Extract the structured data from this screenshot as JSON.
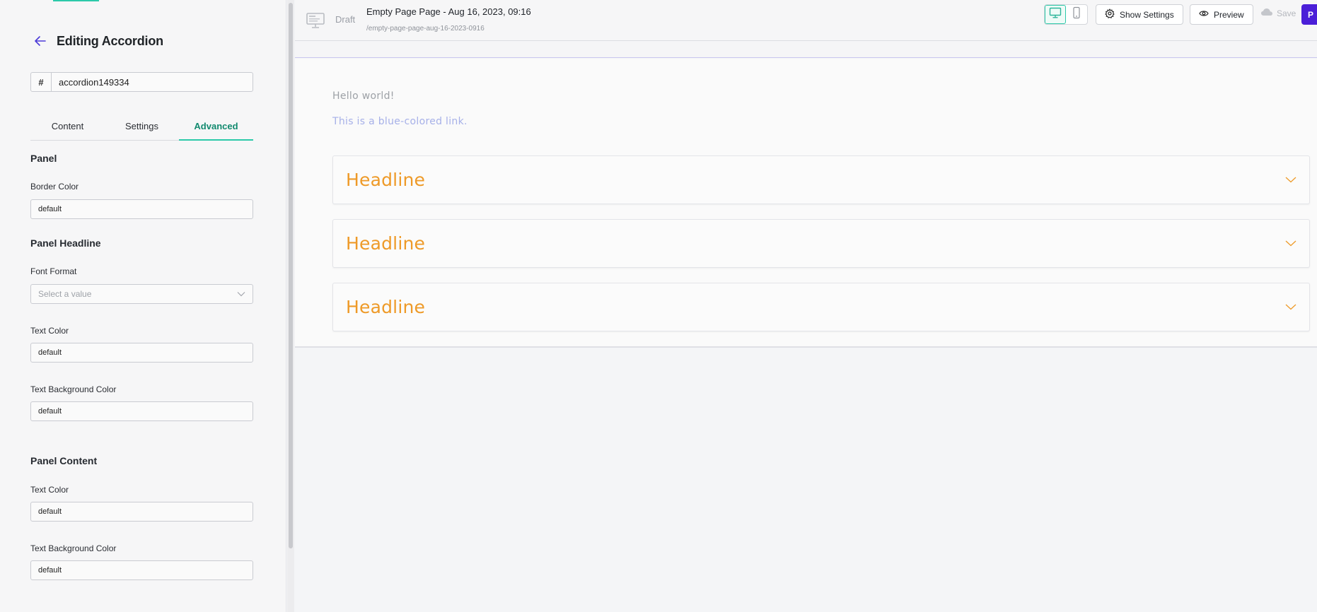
{
  "sidebar": {
    "title": "Editing Accordion",
    "id_prefix": "#",
    "id_value": "accordion149334",
    "tabs": [
      {
        "label": "Content"
      },
      {
        "label": "Settings"
      },
      {
        "label": "Advanced"
      }
    ],
    "active_tab": "Advanced",
    "panel": {
      "title": "Panel",
      "border_color_label": "Border Color",
      "border_color_value": "default"
    },
    "panel_headline": {
      "title": "Panel Headline",
      "font_format_label": "Font Format",
      "font_format_placeholder": "Select a value",
      "text_color_label": "Text Color",
      "text_color_value": "default",
      "text_bg_label": "Text Background Color",
      "text_bg_value": "default"
    },
    "panel_content": {
      "title": "Panel Content",
      "text_color_label": "Text Color",
      "text_color_value": "default",
      "text_bg_label": "Text Background Color",
      "text_bg_value": "default"
    }
  },
  "topbar": {
    "status": "Draft",
    "page_title": "Empty Page Page - Aug 16, 2023, 09:16",
    "page_slug": "/empty-page-page-aug-16-2023-0916",
    "show_settings_label": "Show Settings",
    "preview_label": "Preview",
    "save_label": "Save",
    "publish_label": "P"
  },
  "canvas": {
    "hello_text": "Hello world!",
    "link_text": "This is a blue-colored link.",
    "accordion": [
      {
        "headline": "Headline"
      },
      {
        "headline": "Headline"
      },
      {
        "headline": "Headline"
      }
    ]
  },
  "colors": {
    "accent_teal": "#2cc9a9",
    "active_tab_text": "#128a6f",
    "headline_orange": "#ee9a28",
    "link_blue": "#a6b0e8",
    "publish_purple": "#4b1fd8"
  },
  "icons": [
    "back-arrow-icon",
    "desktop-icon",
    "mobile-icon",
    "gear-icon",
    "eye-icon",
    "cloud-icon",
    "chevron-down-icon",
    "page-monitor-icon"
  ]
}
